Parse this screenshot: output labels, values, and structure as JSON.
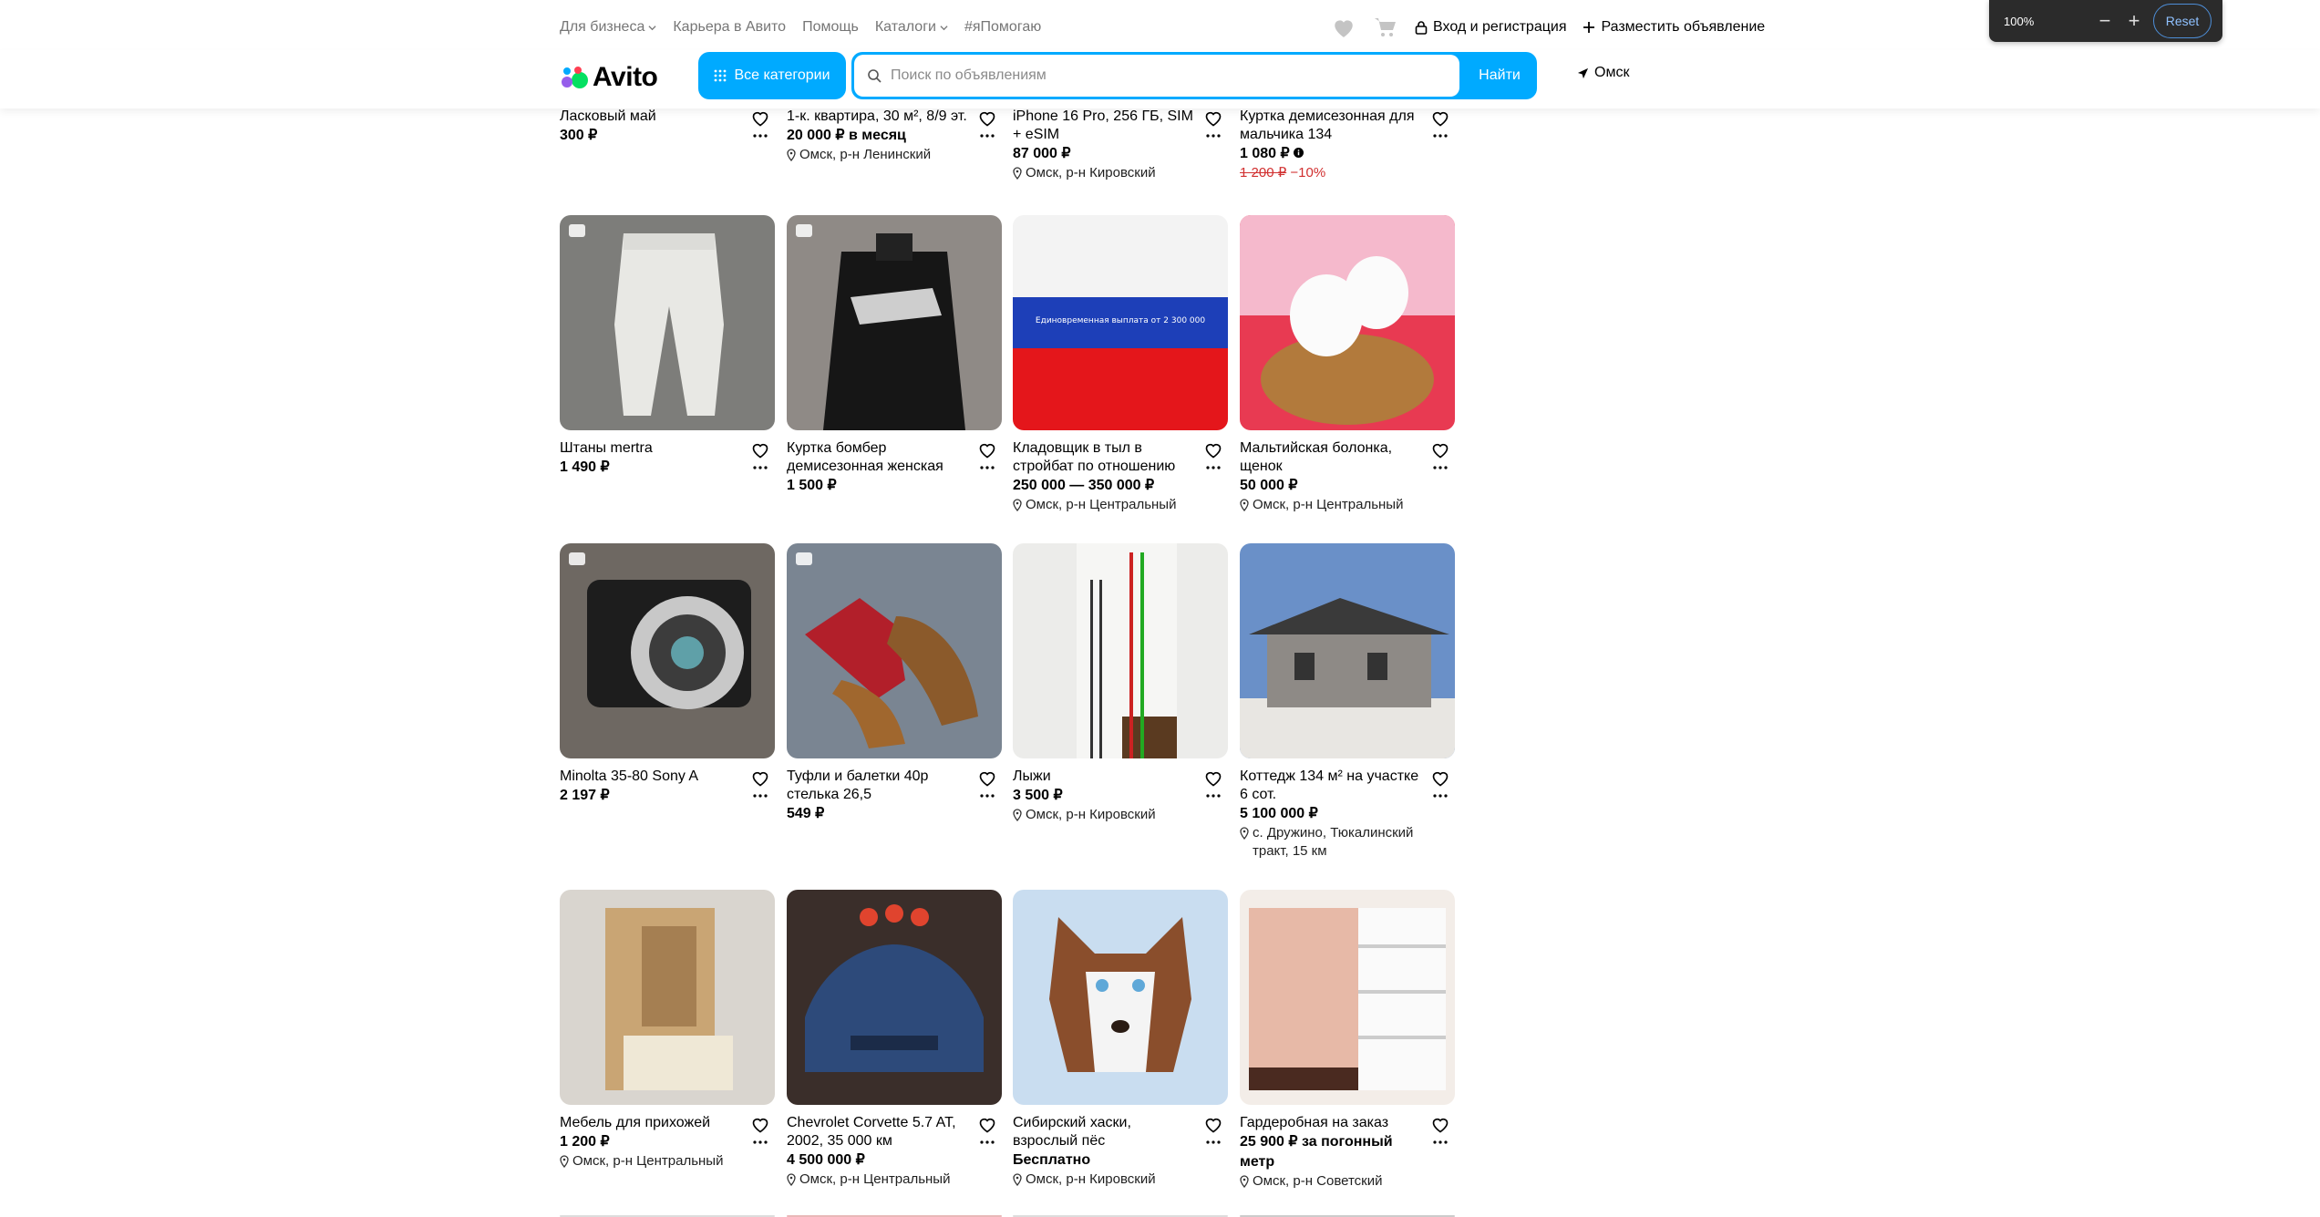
{
  "topnav": {
    "items": [
      {
        "label": "Для бизнеса",
        "dropdown": true
      },
      {
        "label": "Карьера в Авито",
        "dropdown": false
      },
      {
        "label": "Помощь",
        "dropdown": false
      },
      {
        "label": "Каталоги",
        "dropdown": true
      },
      {
        "label": "#яПомогаю",
        "dropdown": false
      }
    ],
    "login_label": "Вход и регистрация",
    "post_ad_label": "Разместить объявление"
  },
  "zoom": {
    "level": "100%",
    "reset_label": "Reset"
  },
  "header": {
    "logo_text": "Avito",
    "categories_label": "Все категории",
    "search_placeholder": "Поиск по объявлениям",
    "search_button": "Найти",
    "city": "Омск"
  },
  "colors": {
    "accent": "#00aaff",
    "discount": "#d12f2f"
  },
  "listings": [
    {
      "title": "Ласковый май",
      "price": "300 ₽"
    },
    {
      "title": "1-к. квартира, 30 м², 8/9 эт.",
      "price": "20 000 ₽ в месяц",
      "location": "Омск, р-н Ленинский"
    },
    {
      "title": "iPhone 16 Pro, 256 ГБ, SIM + eSIM",
      "price": "87 000 ₽",
      "location": "Омск, р-н Кировский"
    },
    {
      "title": "Куртка демисезонная для мальчика 134",
      "price": "1 080 ₽",
      "old_price": "1 200 ₽",
      "discount": "−10%"
    },
    {
      "title": "Штаны mertra",
      "price": "1 490 ₽"
    },
    {
      "title": "Куртка бомбер демисезонная женская",
      "price": "1 500 ₽"
    },
    {
      "title": "Кладовщик в тыл в стройбат по отношению",
      "price": "250 000 — 350 000 ₽",
      "location": "Омск, р-н Центральный",
      "image_text": "Единовременная выплата от 2 300 000"
    },
    {
      "title": "Мальтийская болонка, щенок",
      "price": "50 000 ₽",
      "location": "Омск, р-н Центральный"
    },
    {
      "title": "Minolta 35-80 Sony A",
      "price": "2 197 ₽"
    },
    {
      "title": "Туфли и балетки 40р стелька 26,5",
      "price": "549 ₽"
    },
    {
      "title": "Лыжи",
      "price": "3 500 ₽",
      "location": "Омск, р-н Кировский"
    },
    {
      "title": "Коттедж 134 м² на участке 6 сот.",
      "price": "5 100 000 ₽",
      "location": "с. Дружино, Тюкалинский тракт, 15 км"
    },
    {
      "title": "Мебель для прихожей",
      "price": "1 200 ₽",
      "location": "Омск, р-н Центральный"
    },
    {
      "title": "Chevrolet Corvette 5.7 AT, 2002, 35 000 км",
      "price": "4 500 000 ₽",
      "location": "Омск, р-н Центральный"
    },
    {
      "title": "Сибирский хаски, взрослый пёс",
      "price": "Бесплатно",
      "location": "Омск, р-н Кировский"
    },
    {
      "title": "Гардеробная на заказ",
      "price": "25 900 ₽ за погонный метр",
      "location": "Омск, р-н Советский"
    }
  ]
}
